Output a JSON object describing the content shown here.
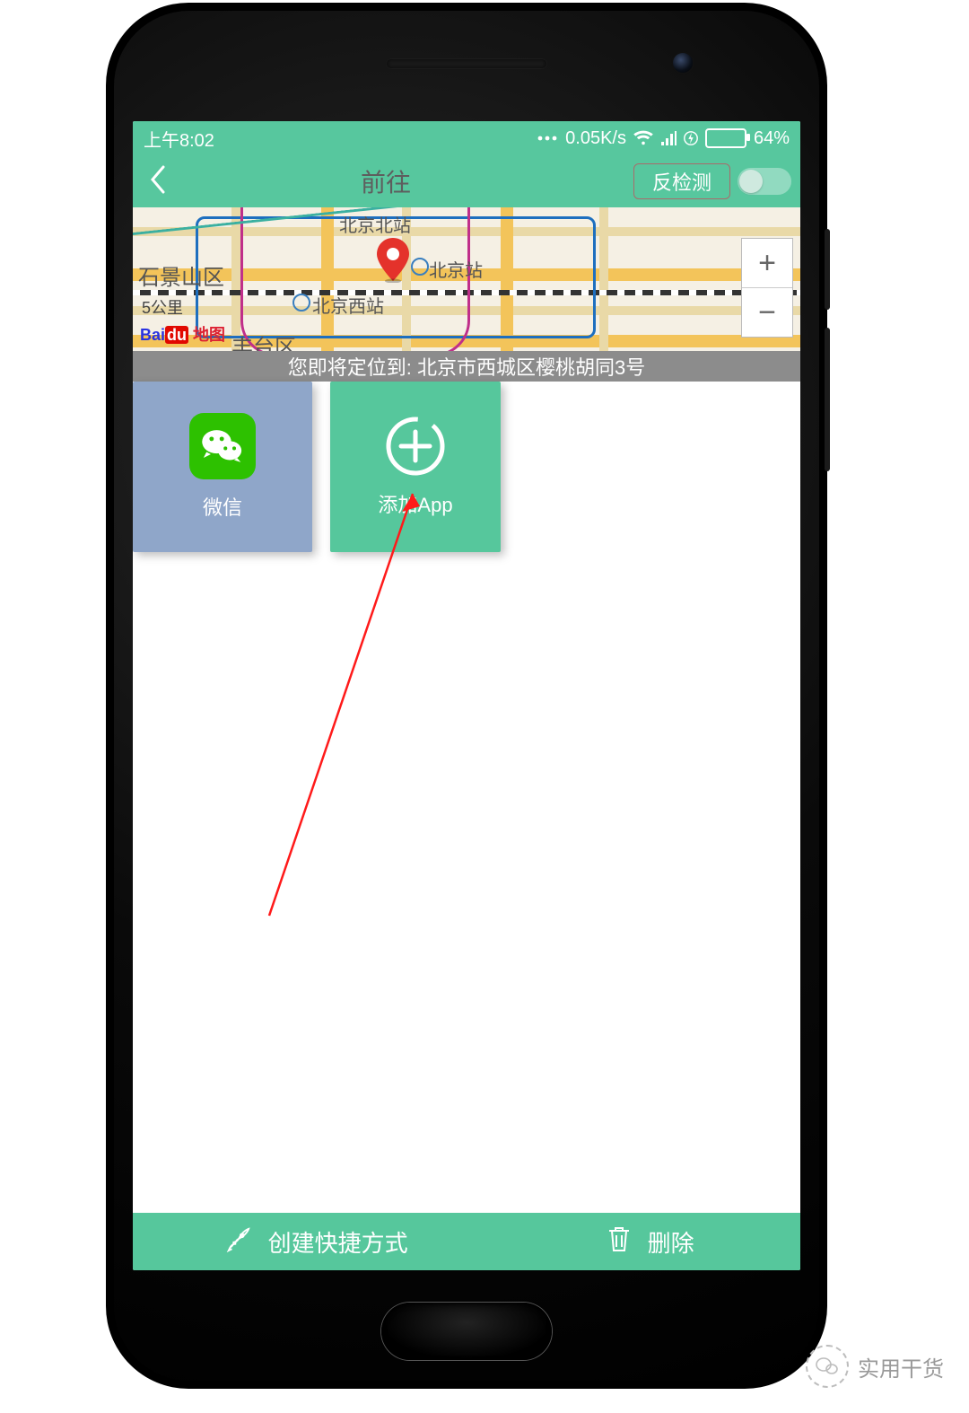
{
  "statusbar": {
    "time": "上午8:02",
    "netspeed": "0.05K/s",
    "battery_pct": "64%"
  },
  "appbar": {
    "title": "前往",
    "chip": "反检测"
  },
  "map": {
    "labels": {
      "shijingshan": "石景山区",
      "bjnorth": "北京北站",
      "bjstation": "北京站",
      "bjwest": "北京西站",
      "fengtai": "丰台区"
    },
    "scale": "5公里",
    "brand_prefix": "Bai",
    "brand_du": "du",
    "brand_suffix": "地图",
    "zoom_in": "+",
    "zoom_out": "−"
  },
  "location_banner": "您即将定位到: 北京市西城区樱桃胡同3号",
  "tiles": {
    "wechat": "微信",
    "add": "添加App"
  },
  "bottombar": {
    "create": "创建快捷方式",
    "delete": "删除"
  },
  "watermark": "实用干货"
}
